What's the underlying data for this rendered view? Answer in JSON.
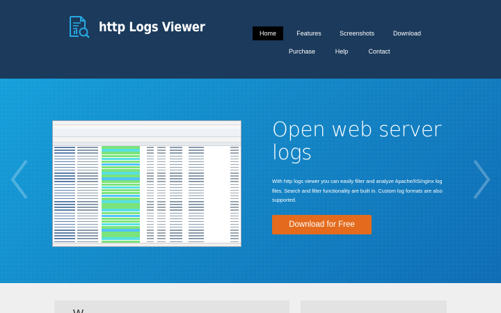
{
  "header": {
    "brand": "http Logs Viewer",
    "logo_icon": "log-search-icon",
    "nav": [
      {
        "label": "Home",
        "active": true
      },
      {
        "label": "Features"
      },
      {
        "label": "Screenshots"
      },
      {
        "label": "Download"
      },
      {
        "label": "Purchase"
      },
      {
        "label": "Help"
      },
      {
        "label": "Contact"
      }
    ]
  },
  "hero": {
    "title": "Open web server logs",
    "description": "With http logs viewer you can easily filter and analyze Apache/IIS/nginx log files. Search and filter functionality are built in. Custom log formats are also supported.",
    "cta_label": "Download for Free",
    "prev_icon": "chevron-left-icon",
    "next_icon": "chevron-right-icon"
  },
  "below": {
    "heading": "W"
  },
  "colors": {
    "header_bg": "#1b3a5c",
    "hero_bg": "#1487c7",
    "cta": "#e46b1d",
    "active_nav": "#000000"
  }
}
